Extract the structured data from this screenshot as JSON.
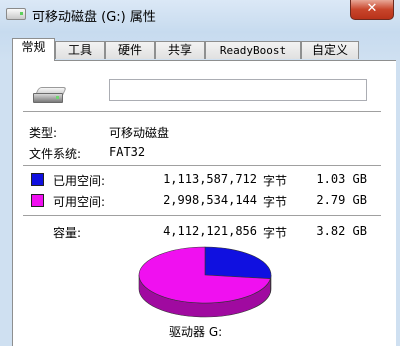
{
  "window": {
    "title": "可移动磁盘 (G:) 属性",
    "close_symbol": "✕"
  },
  "tabs": [
    {
      "label": "常规",
      "active": true
    },
    {
      "label": "工具",
      "active": false
    },
    {
      "label": "硬件",
      "active": false
    },
    {
      "label": "共享",
      "active": false
    },
    {
      "label": "ReadyBoost",
      "active": false
    },
    {
      "label": "自定义",
      "active": false
    }
  ],
  "general": {
    "name_value": "",
    "type_label": "类型:",
    "type_value": "可移动磁盘",
    "fs_label": "文件系统:",
    "fs_value": "FAT32",
    "used": {
      "label": "已用空间:",
      "bytes": "1,113,587,712",
      "unit": "字节",
      "size": "1.03 GB",
      "color": "#1010e0"
    },
    "free": {
      "label": "可用空间:",
      "bytes": "2,998,534,144",
      "unit": "字节",
      "size": "2.79 GB",
      "color": "#f010f0"
    },
    "capacity": {
      "label": "容量:",
      "bytes": "4,112,121,856",
      "unit": "字节",
      "size": "3.82 GB"
    },
    "drive_label": "驱动器 G:"
  },
  "chart_data": {
    "type": "pie",
    "slices": [
      {
        "name": "已用空间",
        "value": 1113587712
      },
      {
        "name": "可用空间",
        "value": 2998534144
      }
    ]
  }
}
